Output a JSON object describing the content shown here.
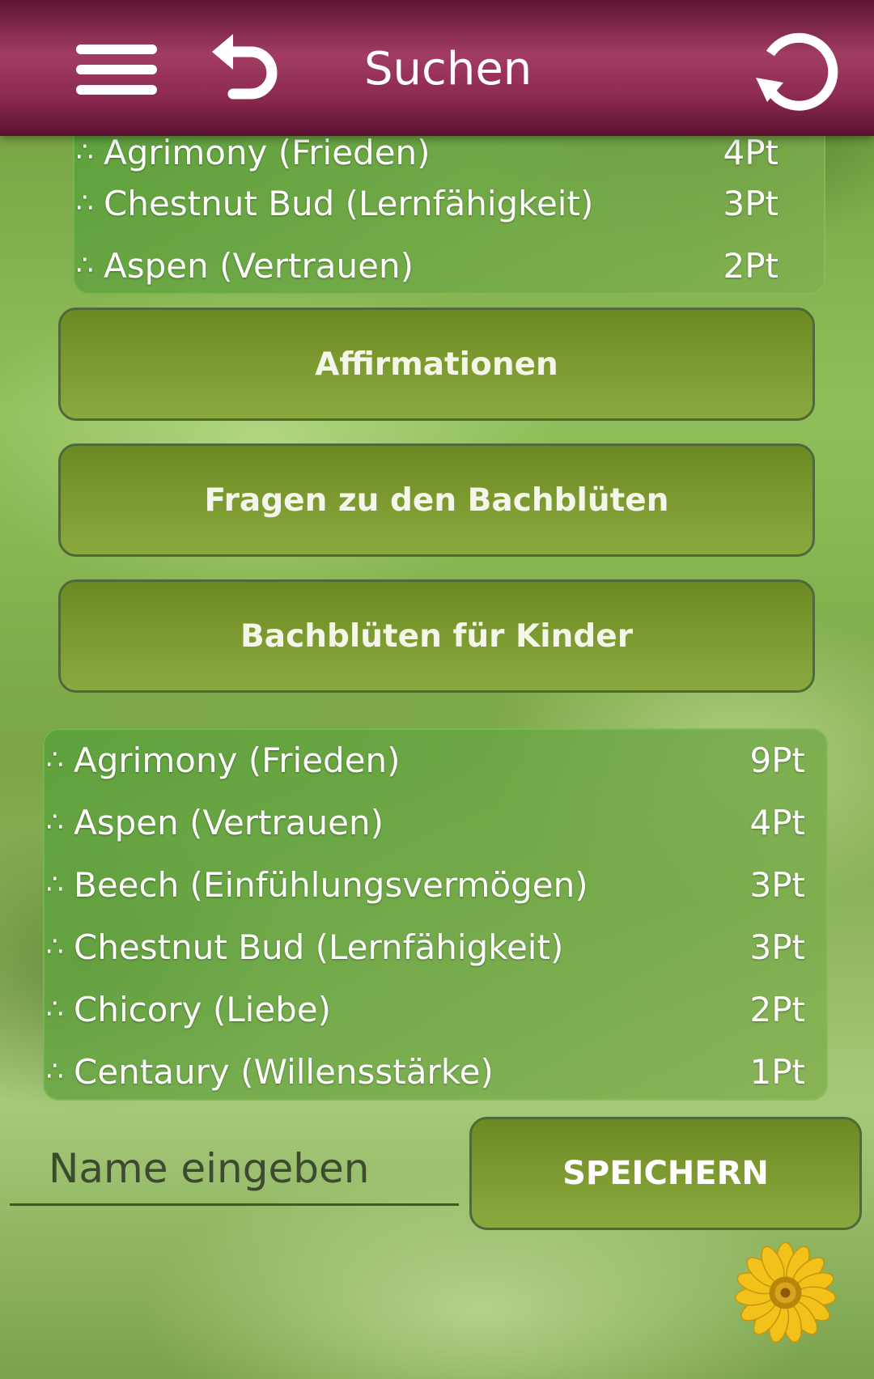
{
  "header": {
    "title": "Suchen",
    "menu_icon": "hamburger-menu-icon",
    "back_icon": "undo-arrow-icon",
    "refresh_icon": "refresh-icon",
    "colors": {
      "bar": "#8e2b52",
      "text": "#ffffff"
    }
  },
  "top_list": {
    "rows": [
      {
        "label": "Agrimony (Frieden)",
        "points": "4Pt"
      },
      {
        "label": "Chestnut Bud (Lernfähigkeit)",
        "points": "3Pt"
      },
      {
        "label": "Aspen (Vertrauen)",
        "points": "2Pt"
      }
    ]
  },
  "buttons": {
    "affirmationen": "Affirmationen",
    "fragen": "Fragen zu den Bachblüten",
    "kinder": "Bachblüten für Kinder"
  },
  "result_list": {
    "bullet": "∴",
    "rows": [
      {
        "label": "Agrimony (Frieden)",
        "points": "9Pt"
      },
      {
        "label": "Aspen (Vertrauen)",
        "points": "4Pt"
      },
      {
        "label": "Beech (Einfühlungsvermögen)",
        "points": "3Pt"
      },
      {
        "label": "Chestnut Bud (Lernfähigkeit)",
        "points": "3Pt"
      },
      {
        "label": "Chicory (Liebe)",
        "points": "2Pt"
      },
      {
        "label": "Centaury (Willensstärke)",
        "points": "1Pt"
      }
    ]
  },
  "save": {
    "placeholder": "Name eingeben",
    "button_label": "SPEICHERN"
  },
  "decor": {
    "flower_icon": "sunflower-icon",
    "accent": "#7c9a30"
  }
}
